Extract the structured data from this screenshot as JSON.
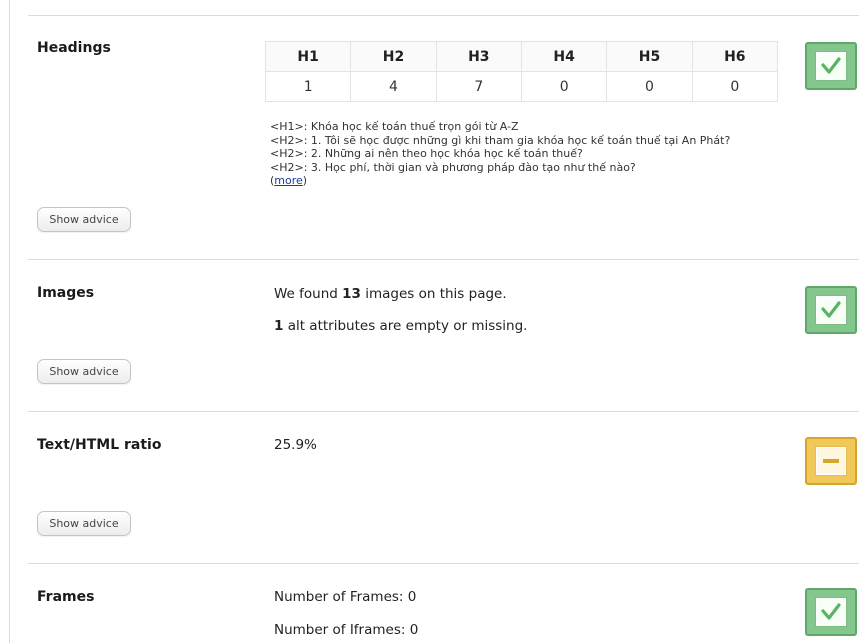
{
  "headings": {
    "title": "Headings",
    "table": {
      "headers": [
        "H1",
        "H2",
        "H3",
        "H4",
        "H5",
        "H6"
      ],
      "values": [
        "1",
        "4",
        "7",
        "0",
        "0",
        "0"
      ]
    },
    "list": [
      "<H1>: Khóa học kế toán thuế trọn gói từ A-Z",
      "<H2>: 1. Tôi sẽ học được những gì khi tham gia khóa học kế toán thuế tại An Phát?",
      "<H2>: 2. Những ai nên theo học khóa học kế toán thuế?",
      "<H2>: 3. Học phí, thời gian và phương pháp đào tạo như thế nào?"
    ],
    "more_open": "(",
    "more_label": "more",
    "more_close": ")",
    "advice_label": "Show advice",
    "status": "check-icon"
  },
  "images": {
    "title": "Images",
    "line1_prefix": "We found ",
    "line1_count": "13",
    "line1_suffix": " images on this page.",
    "line2_count": "1",
    "line2_suffix": " alt attributes are empty or missing.",
    "advice_label": "Show advice",
    "status": "check-icon"
  },
  "ratio": {
    "title": "Text/HTML ratio",
    "value": "25.9%",
    "advice_label": "Show advice",
    "status": "minus-icon"
  },
  "frames": {
    "title": "Frames",
    "frames_line": "Number of Frames: 0",
    "iframes_line": "Number of Iframes: 0",
    "status": "check-icon"
  },
  "colors": {
    "ok": "#84c78c",
    "warn": "#f1c85a",
    "link": "#1a3b9b"
  }
}
